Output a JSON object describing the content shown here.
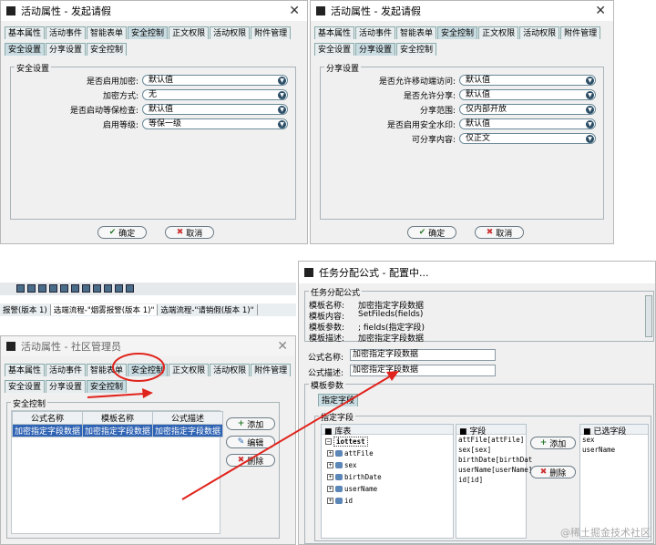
{
  "win1": {
    "title": "活动属性 - 发起请假",
    "tabs": [
      "基本属性",
      "活动事件",
      "智能表单",
      "安全控制",
      "正文权限",
      "活动权限",
      "附件管理"
    ],
    "active_tab": "安全控制",
    "subtabs": [
      "安全设置",
      "分享设置",
      "安全控制"
    ],
    "group_title": "安全设置",
    "fields": [
      {
        "label": "是否启用加密:",
        "value": "默认值"
      },
      {
        "label": "加密方式:",
        "value": "无"
      },
      {
        "label": "是否启动等保检查:",
        "value": "默认值"
      },
      {
        "label": "启用等级:",
        "value": "等保一级"
      }
    ],
    "ok": "确定",
    "cancel": "取消"
  },
  "win2": {
    "title": "活动属性 - 发起请假",
    "tabs": [
      "基本属性",
      "活动事件",
      "智能表单",
      "安全控制",
      "正文权限",
      "活动权限",
      "附件管理"
    ],
    "subtabs": [
      "安全设置",
      "分享设置",
      "安全控制"
    ],
    "group_title": "分享设置",
    "fields": [
      {
        "label": "是否允许移动端访问:",
        "value": "默认值"
      },
      {
        "label": "是否允许分享:",
        "value": "默认值"
      },
      {
        "label": "分享范围:",
        "value": "仅内部开放"
      },
      {
        "label": "是否启用安全水印:",
        "value": "默认值"
      },
      {
        "label": "可分享内容:",
        "value": "仅正文"
      }
    ],
    "ok": "确定",
    "cancel": "取消"
  },
  "doc_tabs": [
    "报警(版本 1)",
    "选端流程-\"烟雾报警(版本 1)\"",
    "选端流程-\"请销假(版本 1)\""
  ],
  "win3": {
    "title": "活动属性 - 社区管理员",
    "tabs": [
      "基本属性",
      "活动事件",
      "智能表单",
      "安全控制",
      "正文权限",
      "活动权限",
      "附件管理"
    ],
    "subtabs": [
      "安全设置",
      "分享设置",
      "安全控制"
    ],
    "group_title": "安全控制",
    "columns": [
      "公式名称",
      "模板名称",
      "公式描述"
    ],
    "rows": [
      [
        "加密指定字段数据",
        "加密指定字段数据",
        "加密指定字段数据"
      ]
    ],
    "add": "添加",
    "edit": "编辑",
    "delete": "删除"
  },
  "win4": {
    "title": "任务分配公式 - 配置中...",
    "group_title": "任务分配公式",
    "info": [
      {
        "label": "模板名称:",
        "value": "加密指定字段数据"
      },
      {
        "label": "模板内容:",
        "value": "SetFileds(fields)"
      },
      {
        "label": "模板参数:",
        "value": "; fields(指定字段)"
      },
      {
        "label": "模板描述:",
        "value": "加密指定字段数据"
      }
    ],
    "name_label": "公式名称:",
    "name_value": "加密指定字段数据",
    "desc_label": "公式描述:",
    "desc_value": "加密指定字段数据",
    "param_group": "模板参数",
    "param_tab": "指定字段",
    "inner_group": "指定字段",
    "table_header": "库表",
    "field_header": "字段",
    "selected_header": "已选字段",
    "table_root": "iottest",
    "tree": [
      "attFile",
      "sex",
      "birthDate",
      "userName",
      "id"
    ],
    "fields": [
      "attFile[attFile]",
      "sex[sex]",
      "birthDate[birthDat",
      "userName[userName]",
      "id[id]"
    ],
    "selected": [
      "sex",
      "userName"
    ],
    "add": "添加",
    "delete": "删除"
  },
  "watermark": "@稀土掘金技术社区",
  "colors": {
    "arrow": "#e0231c",
    "selection": "#2f63b4",
    "tab_active": "#c9dce2"
  }
}
